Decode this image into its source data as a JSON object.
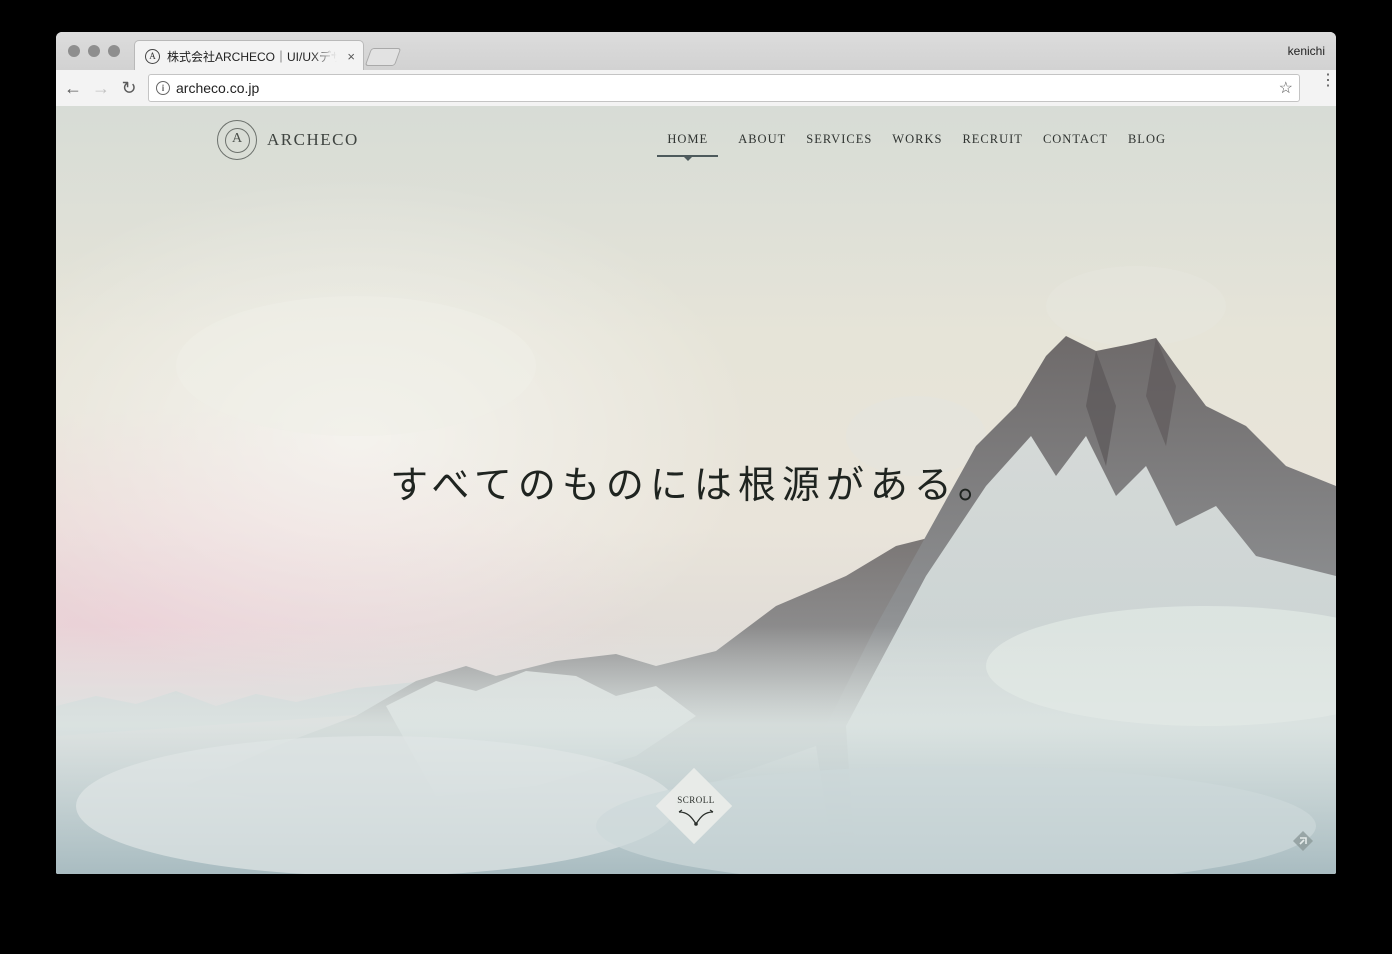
{
  "browser": {
    "tab_title": "株式会社ARCHECO｜UI/UXデザ",
    "tab_favicon": "A",
    "tab_close": "×",
    "profile_name": "kenichi",
    "url": "archeco.co.jp",
    "back": "←",
    "forward": "→",
    "reload": "↻",
    "info": "i",
    "star": "☆",
    "menu": "⋮"
  },
  "site": {
    "logo_text": "ARCHECO",
    "nav": [
      {
        "label": "HOME",
        "active": true
      },
      {
        "label": "ABOUT",
        "active": false
      },
      {
        "label": "SERVICES",
        "active": false
      },
      {
        "label": "WORKS",
        "active": false
      },
      {
        "label": "RECRUIT",
        "active": false
      },
      {
        "label": "CONTACT",
        "active": false
      },
      {
        "label": "BLOG",
        "active": false
      }
    ],
    "hero_text": "すべてのものには根源がある。",
    "scroll_label": "SCROLL"
  }
}
